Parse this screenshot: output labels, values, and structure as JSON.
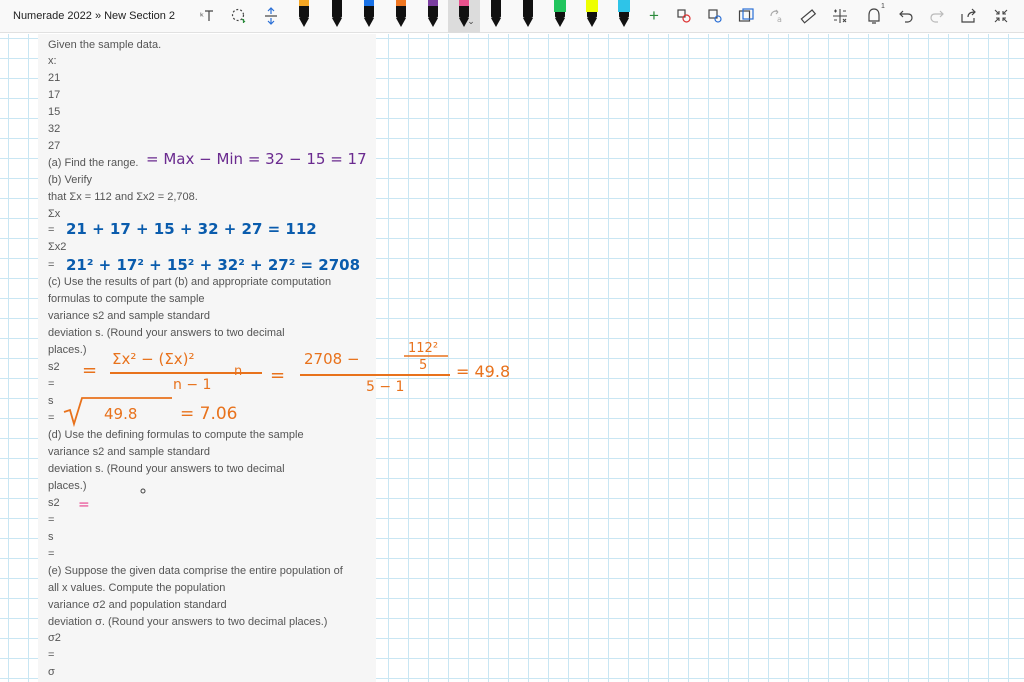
{
  "app": {
    "notebook_title": "Numerade 2022 » New Section 2"
  },
  "toolbar": {
    "icons": [
      "text-select-icon",
      "lasso-icon",
      "space-icon",
      "pen-icon",
      "add-pen-icon",
      "ink-to-shape-icon",
      "ink-to-text-icon",
      "image-icon",
      "ink-replay-icon",
      "ruler-icon",
      "math-icon",
      "notification-icon",
      "undo-icon",
      "redo-icon",
      "share-icon",
      "collapse-icon"
    ],
    "add_label": "+",
    "notification_badge": "1",
    "pens": [
      "#f5a623",
      "#111111",
      "#1a73e8",
      "#f07722",
      "#7b3fa0",
      "#e8528d"
    ],
    "highlighters": [
      "#22c55e",
      "#eeff00",
      "#2ec4e8"
    ]
  },
  "content": {
    "lines": [
      "Given the sample data.",
      "x:",
      "21",
      "17",
      "15",
      "32",
      "27",
      "(a) Find the range.",
      "(b) Verify",
      "that Σx = 112 and Σx2 = 2,708.",
      "Σx",
      "=",
      "Σx2",
      "=",
      "(c) Use the results of part (b) and appropriate computation",
      "formulas to compute the sample",
      "variance s2 and sample standard",
      "deviation s. (Round your answers to two decimal",
      "places.)",
      "s2",
      "=",
      "s",
      "=",
      "(d) Use the defining formulas to compute the sample",
      "variance s2 and sample standard",
      "deviation s. (Round your answers to two decimal",
      "places.)",
      "s2",
      "=",
      "s",
      "=",
      "(e) Suppose the given data comprise the entire population of",
      "all x values. Compute the population",
      "variance σ2 and population standard",
      "deviation σ. (Round your answers to two decimal places.)",
      "σ2",
      "=",
      "σ"
    ]
  },
  "ink": {
    "range": "= Max − Min = 32 − 15 = 17",
    "sum_x": "21 + 17 + 15 + 32 + 27 = 112",
    "sum_x2": "21² + 17² + 15² + 32² + 27² = 2708",
    "s2_lhs": "=",
    "s2_num": "Σx² − (Σx)²",
    "s2_n": "n",
    "s2_den": "n − 1",
    "s2_eq": "=",
    "s2_num2": "2708 −",
    "s2_frac_top": "112²",
    "s2_frac_bot": "5",
    "s2_den2": "5 − 1",
    "s2_result": "= 49.8",
    "s_result": "49.8",
    "s_value": "= 7.06",
    "pink_equals": "="
  },
  "colors": {
    "purple_ink": "#6a2a8f",
    "blue_ink": "#0a5cad",
    "orange_ink": "#e8721c",
    "pink_ink": "#e83e8c",
    "grid": "#c9e6f3"
  }
}
